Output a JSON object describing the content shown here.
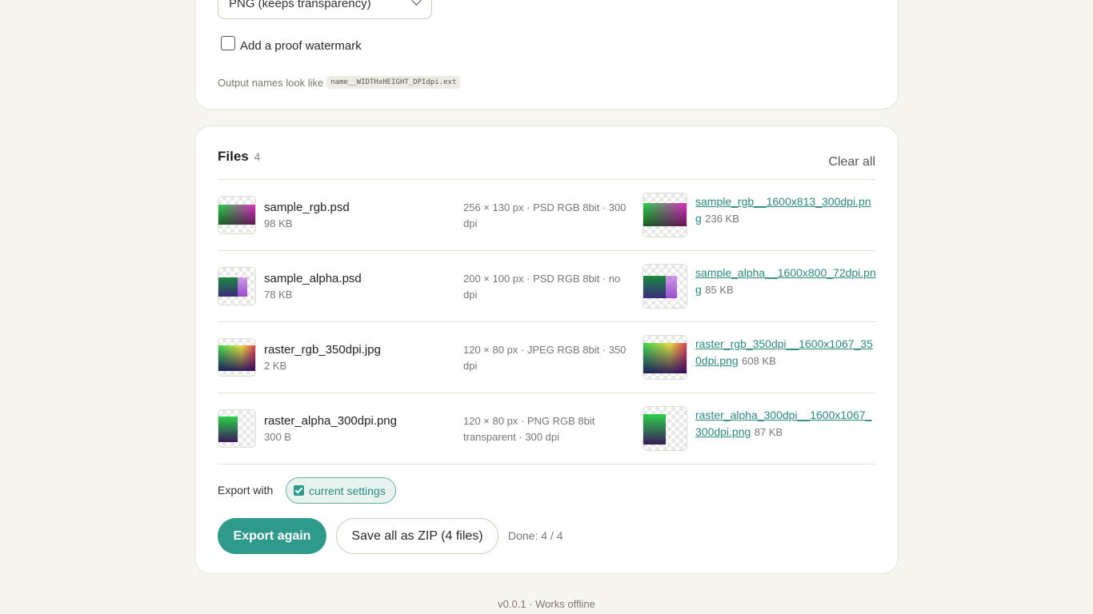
{
  "settings": {
    "format_value": "PNG (keeps transparency)",
    "watermark_label": "Add a proof watermark",
    "watermark_checked": false,
    "naming_hint": "Output names look like",
    "naming_pattern": "name__WIDTHxHEIGHT_DPIdpi.ext"
  },
  "files": {
    "title": "Files",
    "count": "4",
    "clear_label": "Clear all",
    "items": [
      {
        "name": "sample_rgb.psd",
        "size": "98 KB",
        "meta": "256 × 130 px · PSD RGB 8bit · 300 dpi",
        "output_name": "sample_rgb__1600x813_300dpi.png",
        "output_size": "236 KB"
      },
      {
        "name": "sample_alpha.psd",
        "size": "78 KB",
        "meta": "200 × 100 px · PSD RGB 8bit · no dpi",
        "output_name": "sample_alpha__1600x800_72dpi.png",
        "output_size": "85 KB"
      },
      {
        "name": "raster_rgb_350dpi.jpg",
        "size": "2 KB",
        "meta": "120 × 80 px · JPEG RGB 8bit · 350 dpi",
        "output_name": "raster_rgb_350dpi__1600x1067_350dpi.png",
        "output_size": "608 KB"
      },
      {
        "name": "raster_alpha_300dpi.png",
        "size": "300 B",
        "meta": "120 × 80 px · PNG RGB 8bit transparent · 300 dpi",
        "output_name": "raster_alpha_300dpi__1600x1067_300dpi.png",
        "output_size": "87 KB"
      }
    ]
  },
  "export": {
    "with_label": "Export with",
    "settings_chip": "current settings",
    "export_again": "Export again",
    "save_zip": "Save all as ZIP (4 files)",
    "done": "Done: 4 / 4"
  },
  "footer": "v0.0.1 · Works offline",
  "colors": {
    "accent": "#2e9a8b",
    "link": "#2a8a7e",
    "background": "#f7f5ef"
  }
}
